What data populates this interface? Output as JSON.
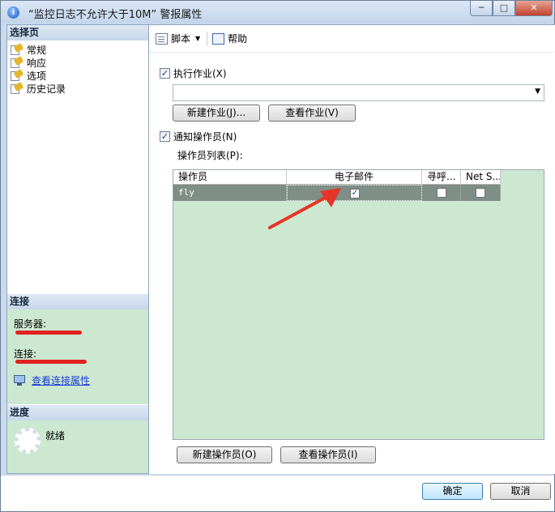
{
  "window": {
    "title": "“监控日志不允许大于10M” 警报属性",
    "icon": "info-icon",
    "minimize_glyph": "─",
    "maximize_glyph": "□",
    "close_glyph": "✕"
  },
  "left_pane": {
    "select_page_header": "选择页",
    "pages": [
      {
        "label": "常规"
      },
      {
        "label": "响应"
      },
      {
        "label": "选项"
      },
      {
        "label": "历史记录"
      }
    ],
    "connection_header": "连接",
    "server_label": "服务器:",
    "connection_label": "连接:",
    "view_connection_link": "查看连接属性",
    "progress_header": "进度",
    "progress_status": "就绪"
  },
  "toolbar": {
    "script_label": "脚本",
    "help_label": "帮助"
  },
  "form": {
    "execute_job_label": "执行作业(X)",
    "execute_job_checked": true,
    "job_combo_value": "",
    "new_job_button": "新建作业(J)...",
    "view_job_button": "查看作业(V)",
    "notify_operators_label": "通知操作员(N)",
    "notify_operators_checked": true,
    "operator_list_label": "操作员列表(P):",
    "grid": {
      "columns": [
        "操作员",
        "电子邮件",
        "寻呼...",
        "Net S..."
      ],
      "rows": [
        {
          "operator": "fly",
          "email": true,
          "pager": false,
          "net_send": false
        }
      ]
    },
    "new_operator_button": "新建操作员(O)",
    "view_operator_button": "查看操作员(I)"
  },
  "footer": {
    "ok_button": "确定",
    "cancel_button": "取消"
  },
  "colors": {
    "accent_green": "#cde8d1",
    "selected_row": "#7f8e86",
    "annotation_red": "#e53528",
    "link_blue": "#1a3dd6"
  }
}
